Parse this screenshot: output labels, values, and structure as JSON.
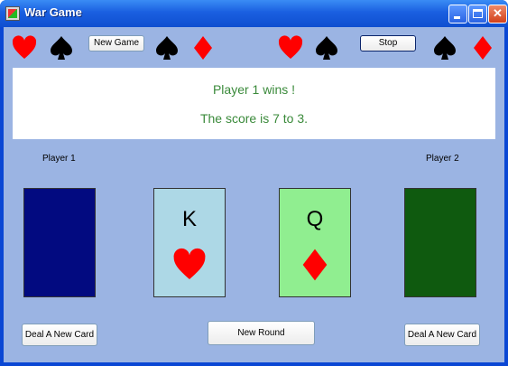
{
  "window": {
    "title": "War Game"
  },
  "toolbar": {
    "new_game_label": "New Game",
    "stop_label": "Stop"
  },
  "message": {
    "line1": "Player 1 wins !",
    "line2": "The score is 7 to 3."
  },
  "players": {
    "player1_label": "Player 1",
    "player2_label": "Player 2"
  },
  "cards": {
    "player1_card": {
      "rank": "K",
      "suit": "heart-icon",
      "color": "#add8e6"
    },
    "player2_card": {
      "rank": "Q",
      "suit": "diamond-icon",
      "color": "#90ee90"
    },
    "deck1_color": "#020a80",
    "deck2_color": "#0f5a0f"
  },
  "buttons": {
    "deal1_label": "Deal  A New Card",
    "deal2_label": "Deal  A New Card",
    "new_round_label": "New Round"
  },
  "colors": {
    "suit_red": "#ff0000",
    "suit_black": "#000000",
    "message_text": "#3a8a3a",
    "background": "#9bb4e3"
  }
}
